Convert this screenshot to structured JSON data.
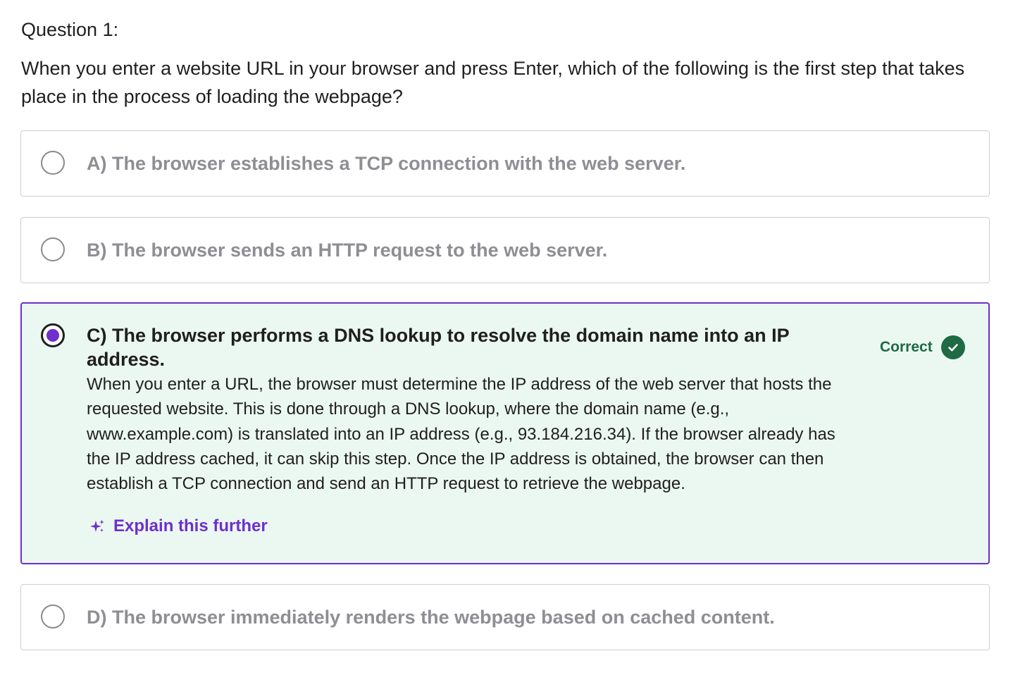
{
  "question": {
    "label": "Question 1:",
    "text": "When you enter a website URL in your browser and press Enter, which of the following is the first step that takes place in the process of loading the webpage?"
  },
  "options": [
    {
      "label": "A) The browser establishes a TCP connection with the web server.",
      "selected": false
    },
    {
      "label": "B) The browser sends an HTTP request to the web server.",
      "selected": false
    },
    {
      "label": "C) The browser performs a DNS lookup to resolve the domain name into an IP address.",
      "selected": true,
      "status": "Correct",
      "explanation": "When you enter a URL, the browser must determine the IP address of the web server that hosts the requested website. This is done through a DNS lookup, where the domain name (e.g., www.example.com) is translated into an IP address (e.g., 93.184.216.34). If the browser already has the IP address cached, it can skip this step. Once the IP address is obtained, the browser can then establish a TCP connection and send an HTTP request to retrieve the webpage.",
      "explain_link": "Explain this further"
    },
    {
      "label": "D) The browser immediately renders the webpage based on cached content.",
      "selected": false
    }
  ],
  "icons": {
    "explain": "sparkle-icon",
    "correct": "check-circle-icon"
  },
  "colors": {
    "accent": "#6e2fcc",
    "correct": "#1d6a45",
    "correct_bg": "#ebf8f1",
    "muted_text": "#8e8e93",
    "border": "#cfcfd3"
  }
}
